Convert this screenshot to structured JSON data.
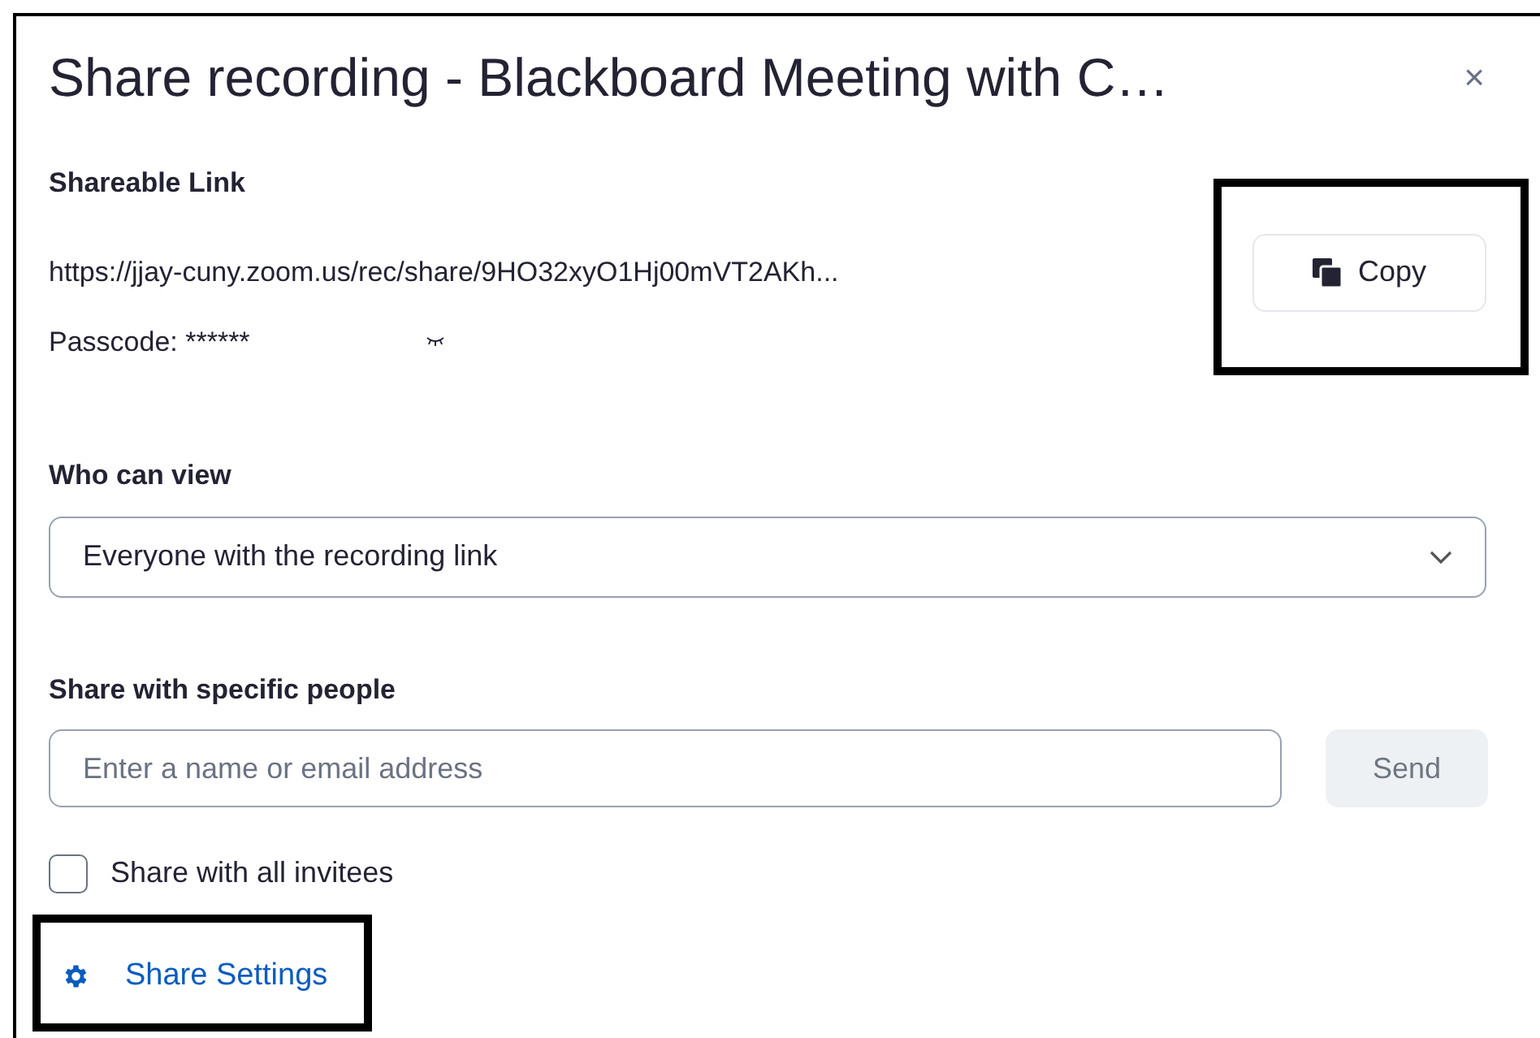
{
  "dialog": {
    "title": "Share recording - Blackboard Meeting with C…",
    "close": "×"
  },
  "shareable_link": {
    "label": "Shareable Link",
    "url": "https://jjay-cuny.zoom.us/rec/share/9HO32xyO1Hj00mVT2AKh...",
    "copy_button": {
      "label": "Copy",
      "highlighted": true
    },
    "passcode": "Passcode: ******"
  },
  "who_can_view": {
    "label": "Who can view",
    "value": "Everyone with the recording link"
  },
  "share_with_people": {
    "label": "Share with specific people",
    "placeholder": "Enter a name or email address",
    "send_button": {
      "label": "Send",
      "disabled": true
    }
  },
  "share_with_all_invitees": {
    "label": "Share with all invitees",
    "checked": false
  },
  "share_settings_link": {
    "label": "Share Settings",
    "highlighted": true
  }
}
